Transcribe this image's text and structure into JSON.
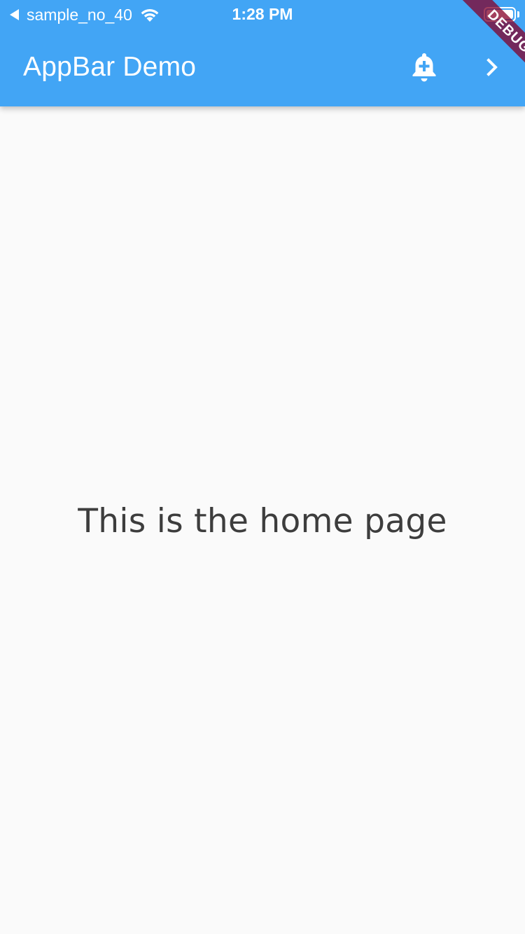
{
  "status_bar": {
    "back_app": "sample_no_40",
    "time": "1:28 PM"
  },
  "app_bar": {
    "title": "AppBar Demo",
    "actions": {
      "notification_icon": "notification-add-icon",
      "next_icon": "chevron-right-icon"
    },
    "background_color": "#42a5f5"
  },
  "debug_banner": {
    "label": "DEBUG"
  },
  "body": {
    "message": "This is the home page",
    "background_color": "#fafafa"
  }
}
